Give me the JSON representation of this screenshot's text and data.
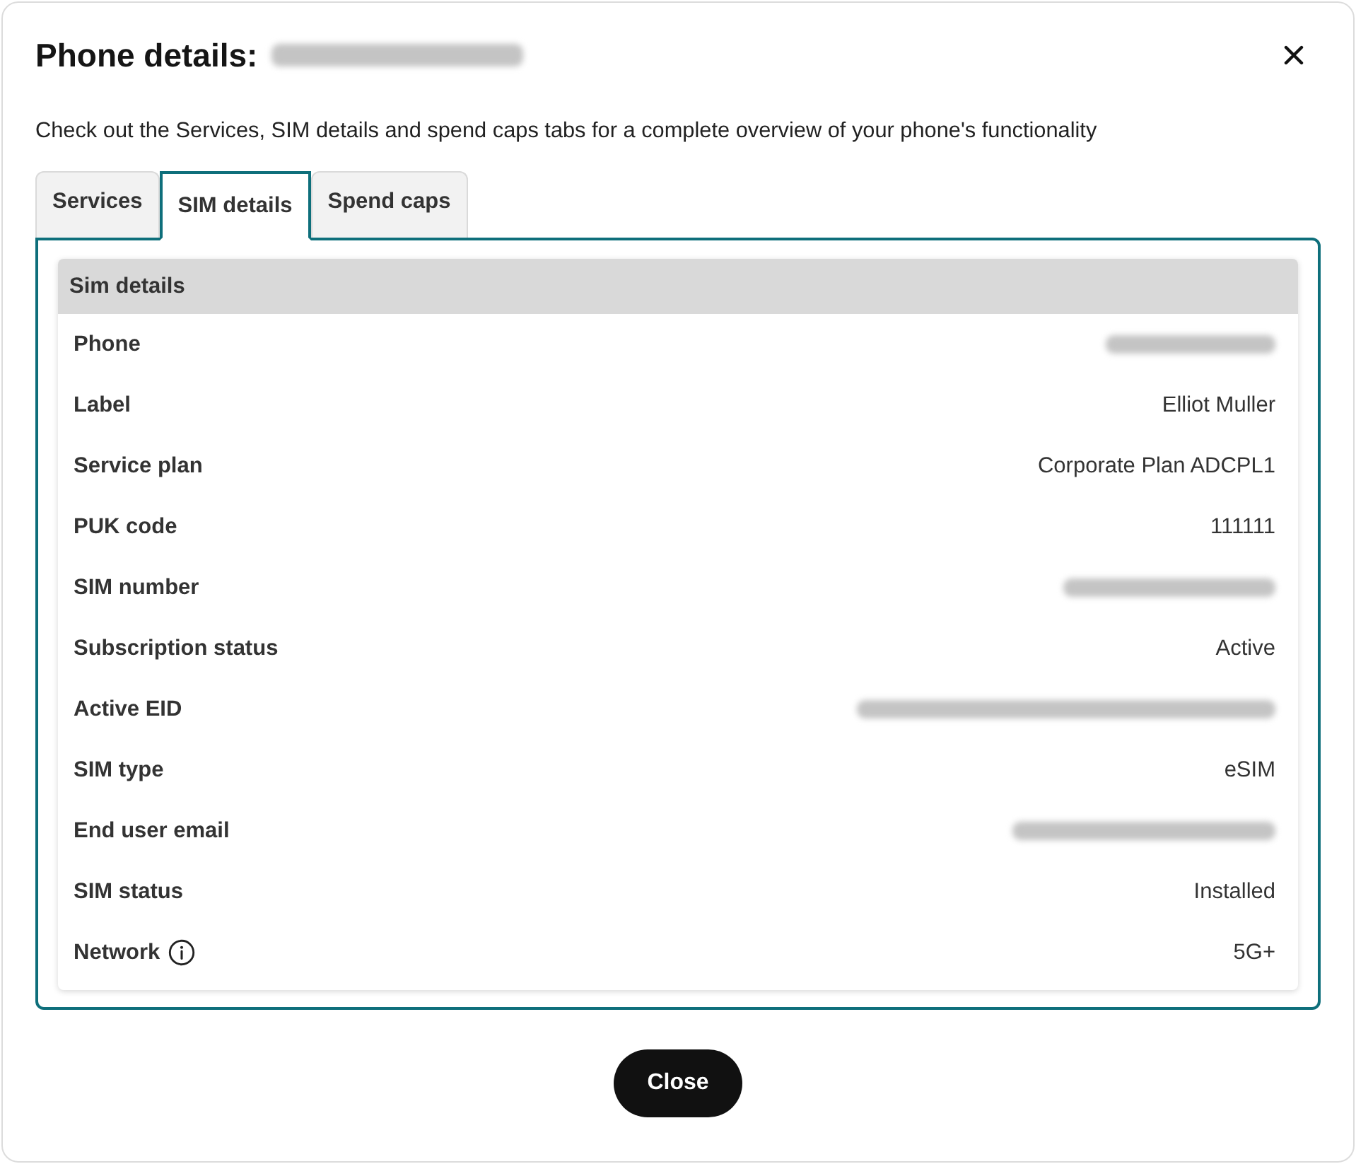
{
  "dialog": {
    "title": "Phone details:",
    "title_number_hidden": true,
    "description": "Check out the Services, SIM details and spend caps tabs for a complete overview of your phone's functionality",
    "tabs": [
      {
        "label": "Services",
        "selected": false
      },
      {
        "label": "SIM details",
        "selected": true
      },
      {
        "label": "Spend caps",
        "selected": false
      }
    ],
    "sim_details": {
      "heading": "Sim details",
      "rows": [
        {
          "label": "Phone",
          "kind": "hidden"
        },
        {
          "label": "Label",
          "kind": "text",
          "value": "Elliot Muller"
        },
        {
          "label": "Service plan",
          "kind": "text",
          "value": "Corporate Plan ADCPL1"
        },
        {
          "label": "PUK code",
          "kind": "text",
          "value": "111111"
        },
        {
          "label": "SIM number",
          "kind": "hidden"
        },
        {
          "label": "Subscription status",
          "kind": "text",
          "value": "Active"
        },
        {
          "label": "Active EID",
          "kind": "hidden"
        },
        {
          "label": "SIM type",
          "kind": "text",
          "value": "eSIM"
        },
        {
          "label": "End user email",
          "kind": "hidden"
        },
        {
          "label": "SIM status",
          "kind": "text",
          "value": "Installed"
        },
        {
          "label": "Network",
          "kind": "text",
          "value": "5G+",
          "info": true
        }
      ]
    },
    "buttons": [
      {
        "label": "Close"
      }
    ]
  }
}
